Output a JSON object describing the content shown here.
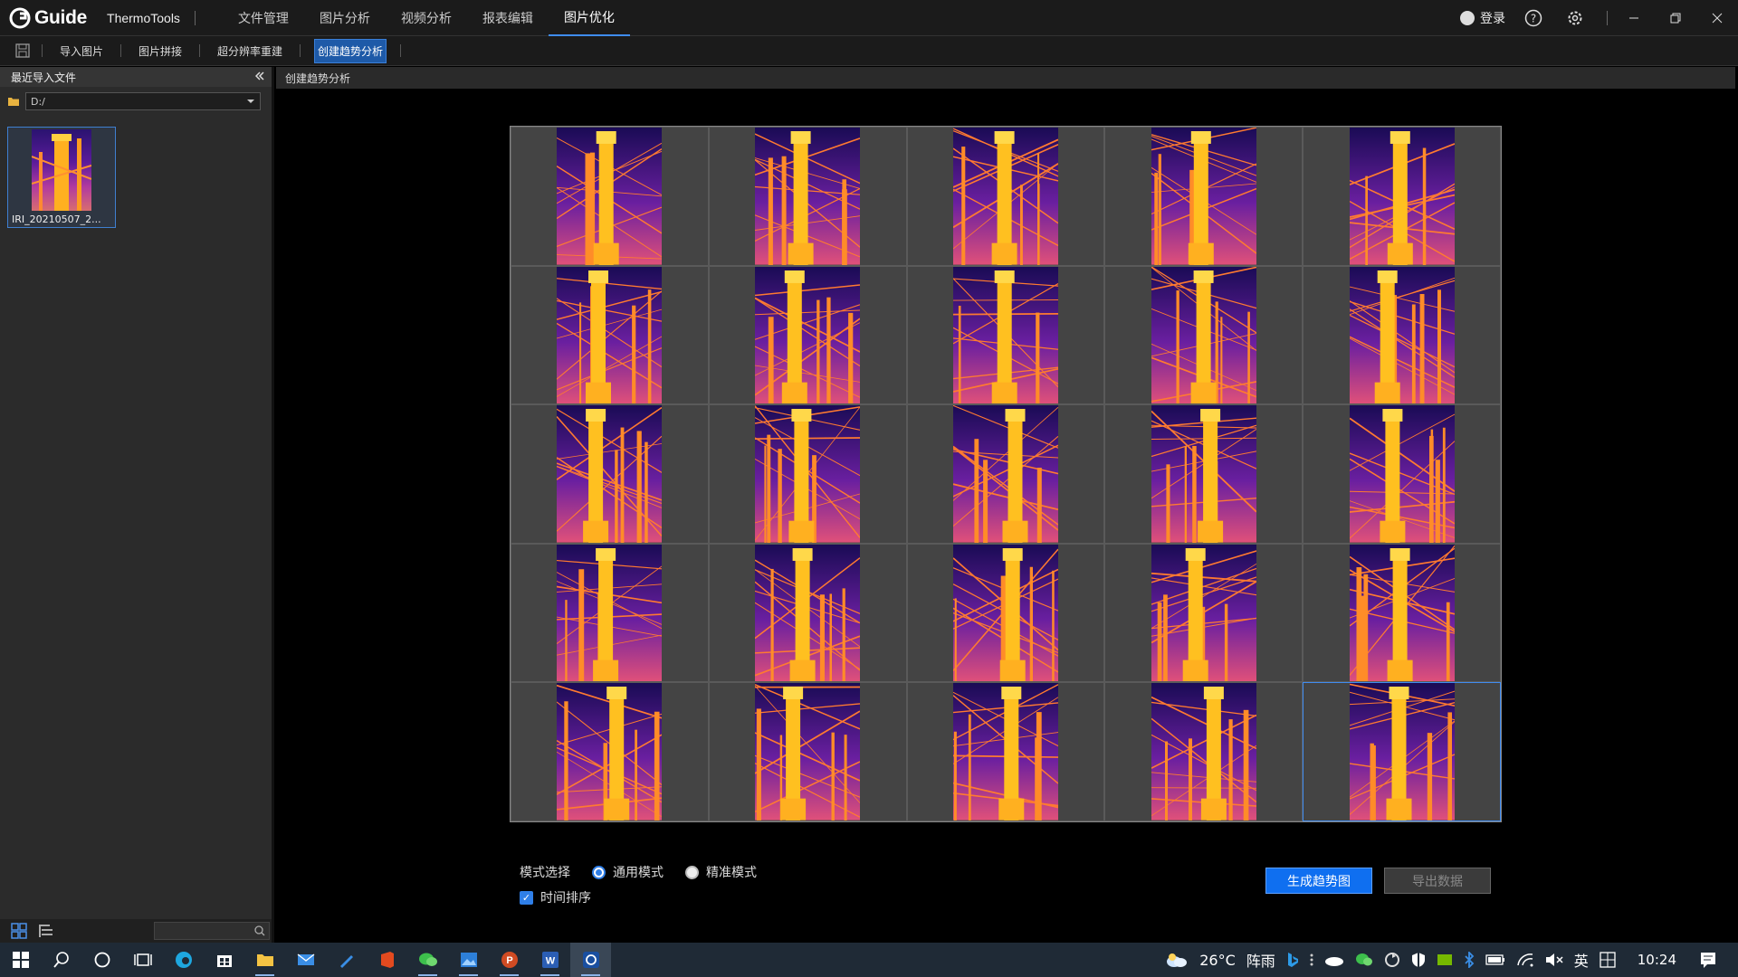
{
  "app": {
    "logo_text": "Guide",
    "name": "ThermoTools"
  },
  "menu": [
    {
      "label": "文件管理"
    },
    {
      "label": "图片分析"
    },
    {
      "label": "视频分析"
    },
    {
      "label": "报表编辑"
    },
    {
      "label": "图片优化",
      "active": true
    }
  ],
  "title_right": {
    "login_label": "登录"
  },
  "toolbar": {
    "buttons": [
      {
        "label": "导入图片"
      },
      {
        "label": "图片拼接"
      },
      {
        "label": "超分辨率重建"
      },
      {
        "label": "创建趋势分析",
        "active": true
      }
    ]
  },
  "sidebar": {
    "title": "最近导入文件",
    "path": "D:/",
    "thumbnail_label": "IRI_20210507_2..."
  },
  "main": {
    "header": "创建趋势分析",
    "grid": {
      "rows": 5,
      "cols": 5,
      "selected_row": 4,
      "selected_col": 4
    },
    "mode_label": "模式选择",
    "mode_options": [
      {
        "label": "通用模式",
        "checked": true
      },
      {
        "label": "精准模式",
        "checked": false
      }
    ],
    "time_sort_label": "时间排序",
    "time_sort_checked": true,
    "generate_button": "生成趋势图",
    "export_button": "导出数据"
  },
  "taskbar": {
    "weather_temp": "26°C",
    "weather_desc": "阵雨",
    "ime": "英",
    "time": "10:24"
  },
  "colors": {
    "accent": "#0f6ff0",
    "thermal_bg": "#1a0b55",
    "thermal_hot": "#ffc020"
  }
}
